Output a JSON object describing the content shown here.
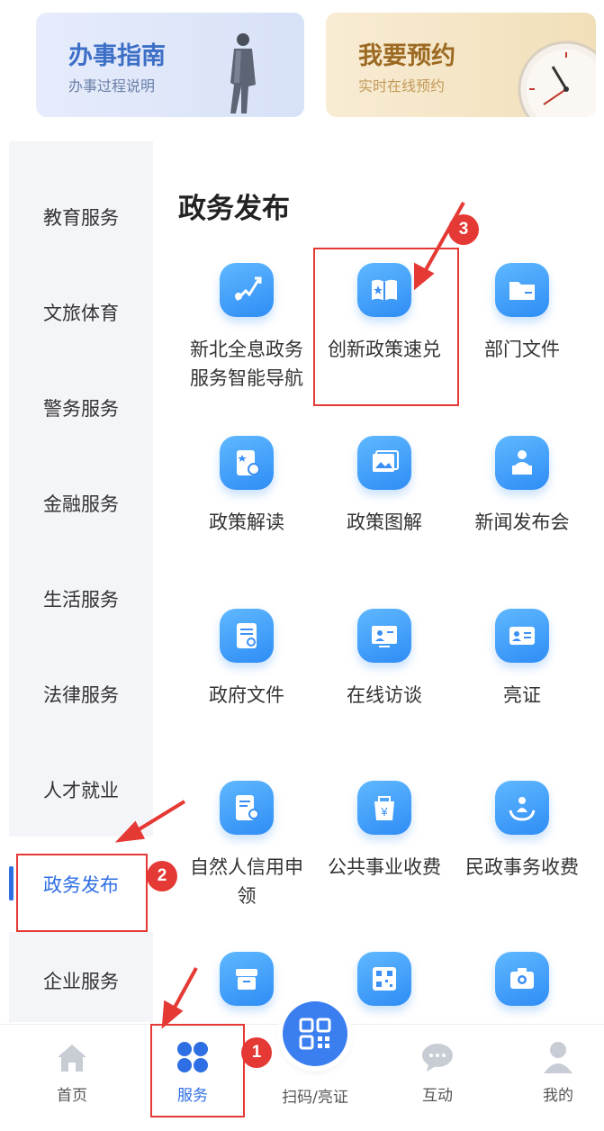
{
  "banners": {
    "guide": {
      "title": "办事指南",
      "subtitle": "办事过程说明"
    },
    "appointment": {
      "title": "我要预约",
      "subtitle": "实时在线预约"
    }
  },
  "sidebar": {
    "items": [
      {
        "label": "教育服务"
      },
      {
        "label": "文旅体育"
      },
      {
        "label": "警务服务"
      },
      {
        "label": "金融服务"
      },
      {
        "label": "生活服务"
      },
      {
        "label": "法律服务"
      },
      {
        "label": "人才就业"
      },
      {
        "label": "政务发布",
        "active": true
      },
      {
        "label": "企业服务"
      }
    ]
  },
  "main": {
    "section_title": "政务发布",
    "items": [
      {
        "label": "新北全息政务服务智能导航",
        "icon": "navigation-icon"
      },
      {
        "label": "创新政策速兑",
        "icon": "policy-book-icon"
      },
      {
        "label": "部门文件",
        "icon": "folder-icon"
      },
      {
        "label": "政策解读",
        "icon": "policy-interpret-icon"
      },
      {
        "label": "政策图解",
        "icon": "policy-graphic-icon"
      },
      {
        "label": "新闻发布会",
        "icon": "press-conference-icon"
      },
      {
        "label": "政府文件",
        "icon": "government-document-icon"
      },
      {
        "label": "在线访谈",
        "icon": "online-interview-icon"
      },
      {
        "label": "亮证",
        "icon": "id-card-icon"
      },
      {
        "label": "自然人信用申领",
        "icon": "credit-icon"
      },
      {
        "label": "公共事业收费",
        "icon": "utility-fee-icon"
      },
      {
        "label": "民政事务收费",
        "icon": "civil-affairs-icon"
      },
      {
        "label": "",
        "icon": "archive-box-icon"
      },
      {
        "label": "",
        "icon": "qr-code-icon"
      },
      {
        "label": "",
        "icon": "camera-icon"
      }
    ]
  },
  "bottom_nav": {
    "home": "首页",
    "service": "服务",
    "scan": "扫码/亮证",
    "interact": "互动",
    "mine": "我的"
  },
  "annotations": {
    "step1": "1",
    "step2": "2",
    "step3": "3"
  },
  "colors": {
    "accent": "#2f6fe4",
    "icon_blue": "#3b8ff5",
    "annotation_red": "#e53935"
  }
}
